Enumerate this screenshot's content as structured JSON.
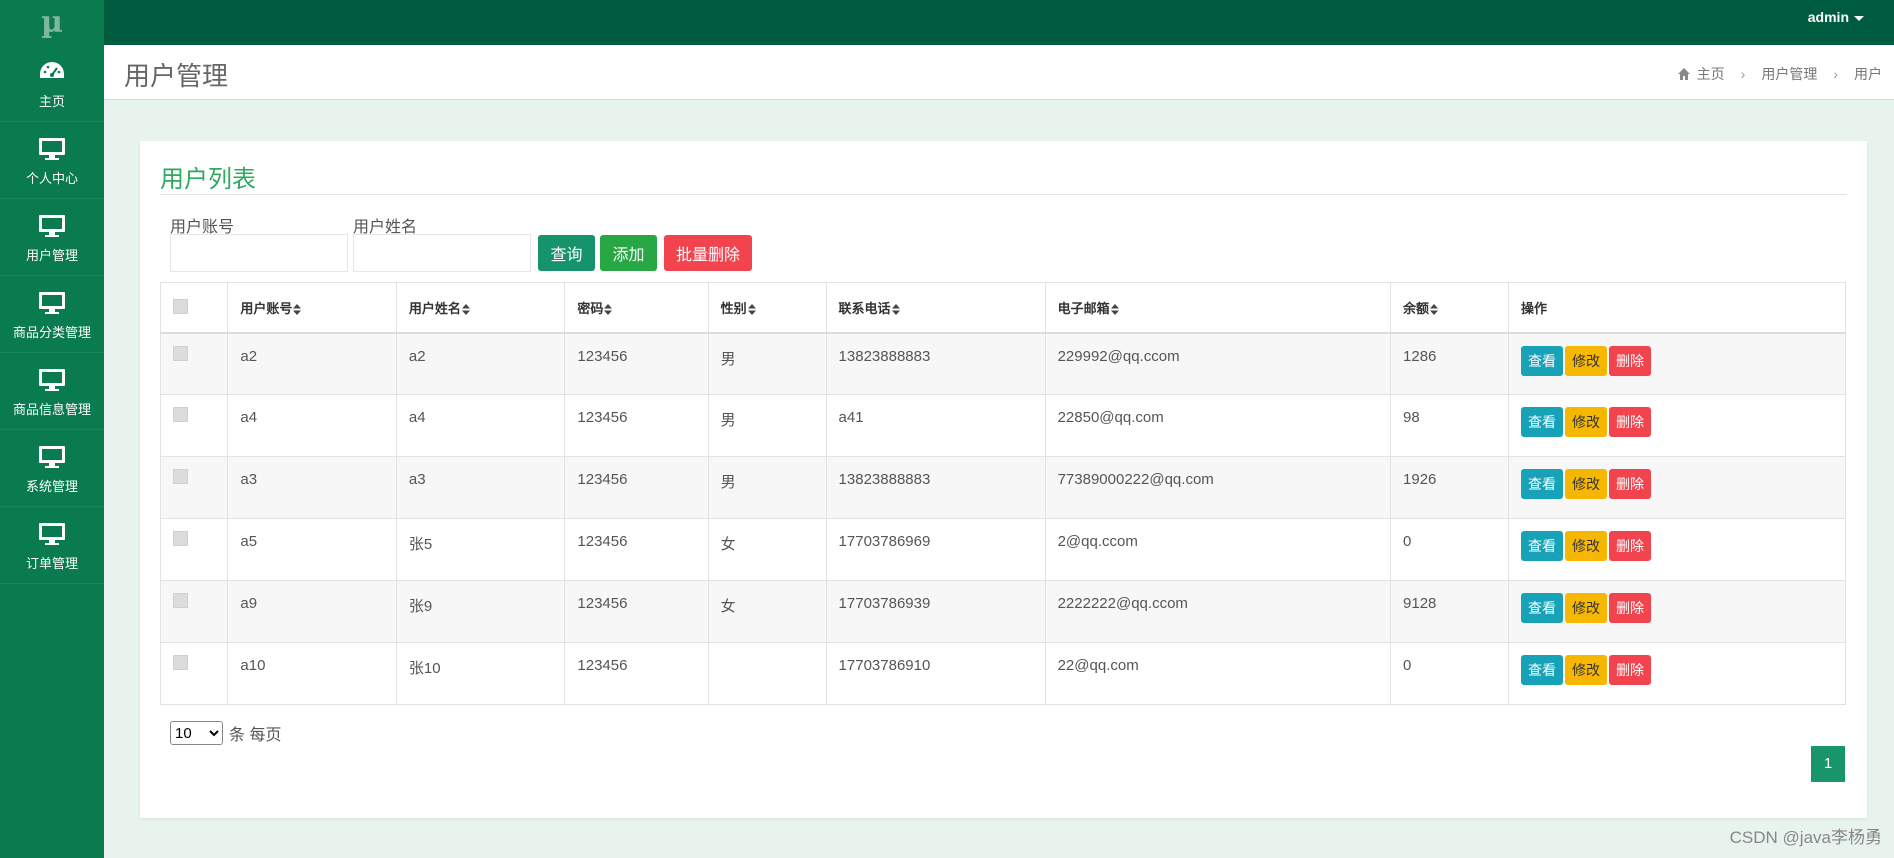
{
  "app": {
    "logo": "µ",
    "user": "admin"
  },
  "sidebar": {
    "items": [
      {
        "label": "主页",
        "icon": "dashboard-icon"
      },
      {
        "label": "个人中心",
        "icon": "monitor-icon"
      },
      {
        "label": "用户管理",
        "icon": "monitor-icon"
      },
      {
        "label": "商品分类管理",
        "icon": "monitor-icon"
      },
      {
        "label": "商品信息管理",
        "icon": "monitor-icon"
      },
      {
        "label": "系统管理",
        "icon": "monitor-icon"
      },
      {
        "label": "订单管理",
        "icon": "monitor-icon"
      }
    ]
  },
  "header": {
    "title": "用户管理",
    "breadcrumb": [
      "主页",
      "用户管理",
      "用户"
    ]
  },
  "card": {
    "title": "用户列表",
    "filters": {
      "account_label": "用户账号",
      "account_value": "",
      "name_label": "用户姓名",
      "name_value": ""
    },
    "buttons": {
      "query": "查询",
      "add": "添加",
      "batch_delete": "批量删除"
    }
  },
  "table": {
    "columns": [
      "用户账号",
      "用户姓名",
      "密码",
      "性别",
      "联系电话",
      "电子邮箱",
      "余额",
      "操作"
    ],
    "actions": {
      "view": "查看",
      "edit": "修改",
      "delete": "删除"
    },
    "rows": [
      {
        "account": "a2",
        "name": "a2",
        "password": "123456",
        "gender": "男",
        "phone": "13823888883",
        "email": "229992@qq.ccom",
        "balance": "1286"
      },
      {
        "account": "a4",
        "name": "a4",
        "password": "123456",
        "gender": "男",
        "phone": "a41",
        "email": "22850@qq.com",
        "balance": "98"
      },
      {
        "account": "a3",
        "name": "a3",
        "password": "123456",
        "gender": "男",
        "phone": "13823888883",
        "email": "77389000222@qq.com",
        "balance": "1926"
      },
      {
        "account": "a5",
        "name": "张5",
        "password": "123456",
        "gender": "女",
        "phone": "17703786969",
        "email": "2@qq.ccom",
        "balance": "0"
      },
      {
        "account": "a9",
        "name": "张9",
        "password": "123456",
        "gender": "女",
        "phone": "17703786939",
        "email": "2222222@qq.ccom",
        "balance": "9128"
      },
      {
        "account": "a10",
        "name": "张10",
        "password": "123456",
        "gender": "",
        "phone": "17703786910",
        "email": "22@qq.com",
        "balance": "0"
      }
    ]
  },
  "pagination": {
    "page_size": "10",
    "page_size_options": [
      "10"
    ],
    "page_size_suffix": "条 每页",
    "current_page": "1"
  },
  "watermark": "CSDN @java李杨勇",
  "colors": {
    "brand_dark": "#005c3f",
    "brand": "#0a7a4f",
    "accent": "#2eaa5e",
    "danger": "#f2444f",
    "warning": "#f5b700",
    "info": "#17a2b8"
  }
}
